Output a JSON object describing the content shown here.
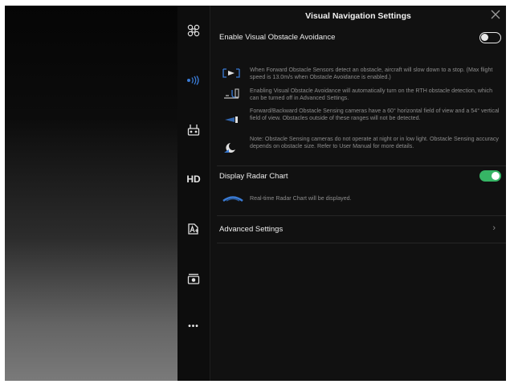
{
  "panel": {
    "title": "Visual Navigation Settings"
  },
  "sidebar": {
    "items": [
      {
        "name": "aircraft-icon",
        "label": ""
      },
      {
        "name": "signal-icon",
        "label": ""
      },
      {
        "name": "remote-controller-icon",
        "label": ""
      },
      {
        "name": "hd-icon",
        "label": "HD"
      },
      {
        "name": "battery-icon",
        "label": ""
      },
      {
        "name": "camera-icon",
        "label": ""
      },
      {
        "name": "more-icon",
        "label": "•••"
      }
    ],
    "active_color": "#3a7bd5"
  },
  "obstacle_avoidance": {
    "label": "Enable Visual Obstacle Avoidance",
    "enabled": false,
    "notes": [
      "When Forward Obstacle Sensors detect an obstacle, aircraft will slow down to a stop. (Max flight speed is 13.0m/s when Obstacle Avoidance is enabled.)",
      "Enabling Visual Obstacle Avoidance will automatically turn on the RTH obstacle detection, which can be turned off in Advanced Settings.",
      "Forward/Backward Obstacle Sensing cameras have a 60° horizontal field of view and a 54° vertical field of view. Obstacles outside of these ranges will not be detected.",
      "Note: Obstacle Sensing cameras do not operate at night or in low light. Obstacle Sensing accuracy depends on obstacle size. Refer to User Manual for more details."
    ]
  },
  "radar_chart": {
    "label": "Display Radar Chart",
    "enabled": true,
    "note": "Real-time Radar Chart will be displayed.",
    "toggle_color": "#36b565"
  },
  "advanced": {
    "label": "Advanced Settings",
    "chevron": "›"
  },
  "close_icon": "close-icon"
}
